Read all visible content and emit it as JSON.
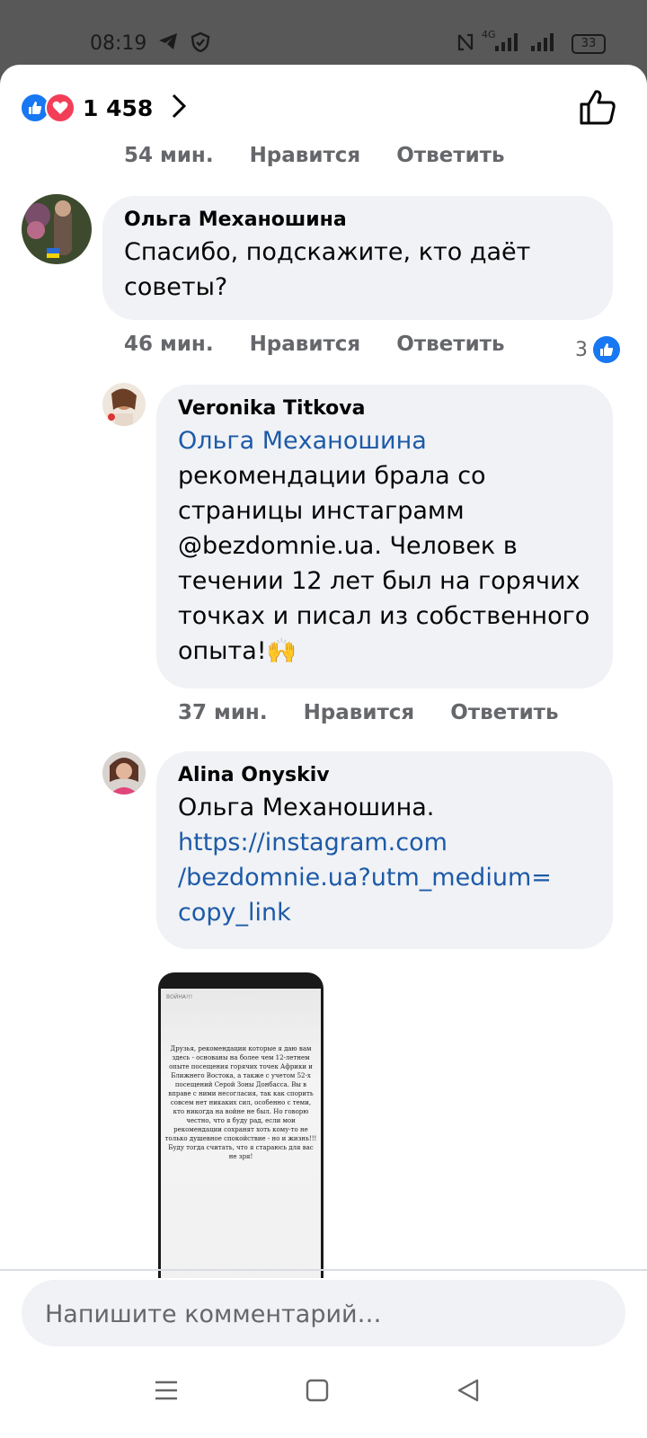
{
  "status_bar": {
    "time": "08:19",
    "network": "4G",
    "battery": "33",
    "icons": [
      "telegram-icon",
      "shield-icon",
      "nfc-icon",
      "signal-icon",
      "battery-icon"
    ]
  },
  "reactions": {
    "count": "1 458",
    "icons": [
      "like-reaction-icon",
      "love-reaction-icon"
    ],
    "colors": {
      "like": "#1877f2",
      "love": "#f33e58"
    }
  },
  "actions": {
    "like": "Нравится",
    "reply": "Ответить"
  },
  "top_comment_time": "54 мин.",
  "comments": [
    {
      "author": "Ольга Механошина",
      "text": "Спасибо, подскажите, кто даёт советы?",
      "time": "46 мин.",
      "likes": "3"
    },
    {
      "author": "Veronika Titkova",
      "mention": "Ольга Механошина",
      "text": "рекомендации брала со страницы инстаграмм @bezdomnie.ua. Человек в течении 12 лет был на горячих точках и писал из собственного опыта!🙌",
      "time": "37 мин."
    },
    {
      "author": "Alina Onyskiv",
      "text": "Ольга Механошина.",
      "link": "https://instagram.com/bezdomnie.ua?utm_medium=copy_link",
      "link_lines": [
        "https://instagram.com",
        "/bezdomnie.ua?utm_medium=",
        "copy_link"
      ]
    }
  ],
  "attachment": {
    "header": "ВОЙНА!!!",
    "text": "Друзья, рекомендации которые я даю вам здесь - основаны на более чем 12-летнем опыте посещения горячих точек Африки и Ближнего Востока, а также с учетом 52-х посещений Серой Зоны Донбасса. Вы в вправе с ними несогласия, так как спорить совсем нет никаких сил, особенно с теми, кто никогда на войне не был. Но говорю честно, что я буду рад, если мои рекомендации сохранят хоть кому-то не только душевное спокойствие - но и жизнь!!! Буду тогда считать, что я стараюсь для вас не зря!"
  },
  "composer": {
    "placeholder": "Напишите комментарий…"
  },
  "nav_bar": {
    "icons": [
      "menu-icon",
      "home-square-icon",
      "back-triangle-icon"
    ]
  }
}
